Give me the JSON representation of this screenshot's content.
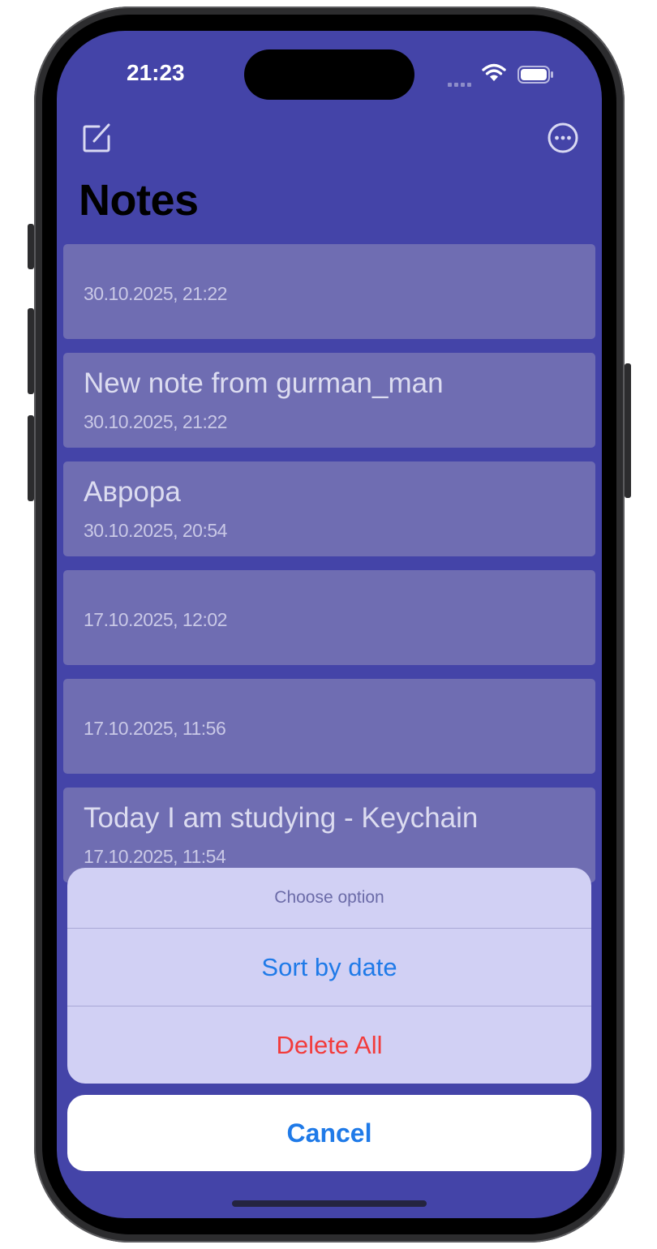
{
  "status_bar": {
    "time": "21:23",
    "icons": [
      "cellular-signal-icon",
      "wifi-icon",
      "battery-icon"
    ]
  },
  "nav": {
    "compose_icon": "compose-icon",
    "more_icon": "ellipsis-circle-icon"
  },
  "page": {
    "title": "Notes"
  },
  "notes": [
    {
      "title": "",
      "date": "30.10.2025, 21:22"
    },
    {
      "title": "New note from gurman_man",
      "date": "30.10.2025, 21:22"
    },
    {
      "title": "Аврора",
      "date": "30.10.2025, 20:54"
    },
    {
      "title": "",
      "date": "17.10.2025, 12:02"
    },
    {
      "title": "",
      "date": "17.10.2025, 11:56"
    },
    {
      "title": "Today I am studying - Keychain",
      "date": "17.10.2025, 11:54"
    }
  ],
  "action_sheet": {
    "title": "Choose option",
    "options": [
      {
        "label": "Sort by date",
        "style": "default"
      },
      {
        "label": "Delete All",
        "style": "destructive"
      }
    ],
    "cancel_label": "Cancel"
  },
  "colors": {
    "background": "#4444a8",
    "card": "#6f6db2",
    "sheet": "#d1d0f4",
    "accent": "#1f7ae8",
    "destructive": "#f23b3b"
  }
}
